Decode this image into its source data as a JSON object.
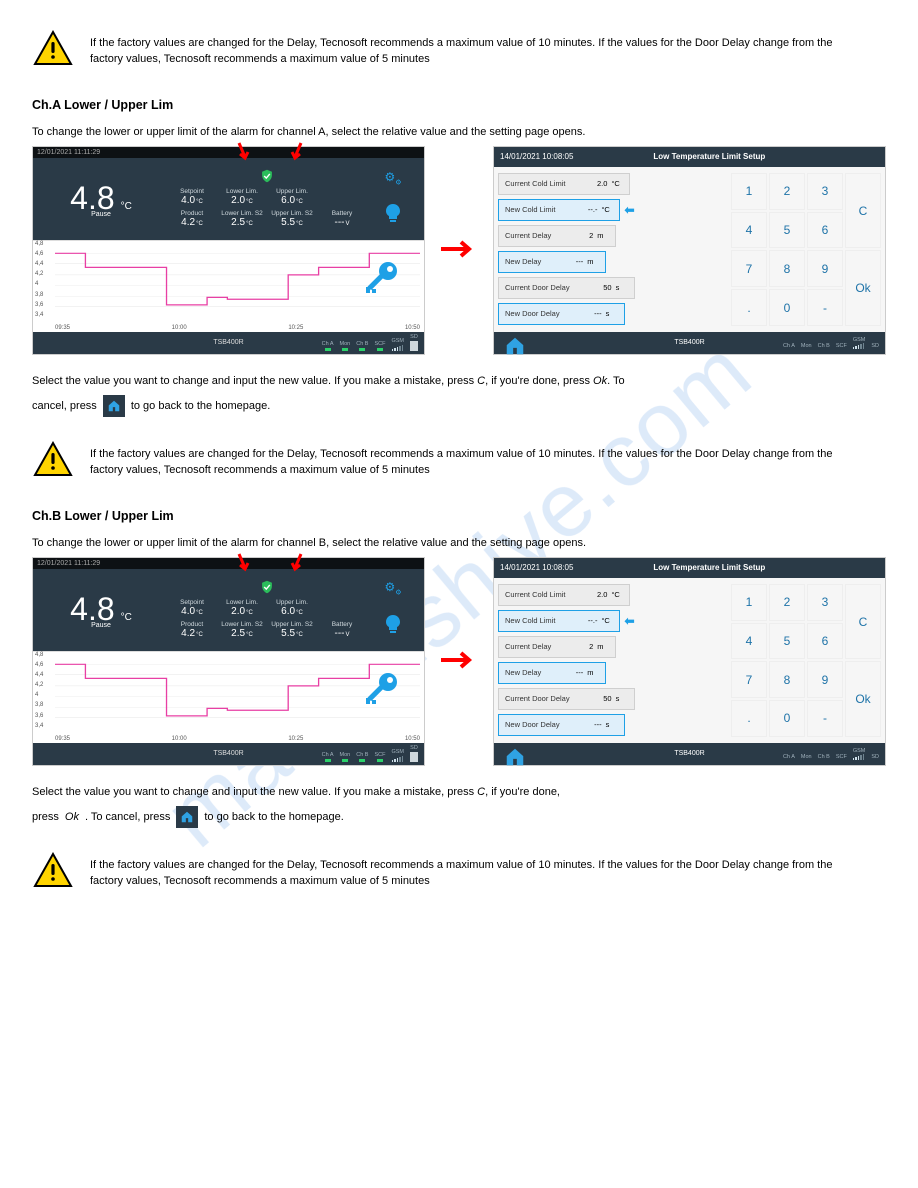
{
  "watermark": "manualshive.com",
  "warn1_text": "If the factory values are changed for the Delay, Tecnosoft recommends a maximum value of 10 minutes. If the\nvalues for the Door Delay change from the factory values, Tecnosoft recommends a maximum value of 5 minutes",
  "section2_title": "Ch.A Lower / Upper Lim",
  "section2_desc": "To change the lower or upper limit of the alarm for channel A, select the relative value and the setting page opens.",
  "left": {
    "timestamp": "12/01/2021 11:11:29",
    "temp_value": "4.8",
    "temp_unit": "°C",
    "pause": "Pause",
    "row1": [
      {
        "lbl": "Setpoint",
        "val": "4.0",
        "unit": "°C"
      },
      {
        "lbl": "Lower Lim.",
        "val": "2.0",
        "unit": "°C"
      },
      {
        "lbl": "Upper Lim.",
        "val": "6.0",
        "unit": "°C"
      }
    ],
    "row2": [
      {
        "lbl": "Product",
        "val": "4.2",
        "unit": "°C"
      },
      {
        "lbl": "Lower Lim. S2",
        "val": "2.5",
        "unit": "°C"
      },
      {
        "lbl": "Upper Lim. S2",
        "val": "5.5",
        "unit": "°C"
      },
      {
        "lbl": "Battery",
        "val": "---",
        "unit": "V"
      }
    ],
    "model": "TSB400R",
    "status_labels": [
      "Ch A",
      "Mon",
      "Ch B",
      "SCF",
      "GSM",
      "SD"
    ],
    "chart_y": [
      "4,8",
      "4,6",
      "4,4",
      "4,2",
      "4",
      "3,8",
      "3,6",
      "3,4"
    ],
    "chart_x": [
      "09:35",
      "10:00",
      "10:25",
      "10:50"
    ]
  },
  "right": {
    "timestamp": "14/01/2021 10:08:05",
    "title": "Low Temperature Limit Setup",
    "rows": [
      {
        "label": "Current Cold Limit",
        "val": "2.0",
        "unit": "°C",
        "active": false
      },
      {
        "label": "New Cold Limit",
        "val": "--.-",
        "unit": "°C",
        "active": true,
        "sel": true
      },
      {
        "label": "Current Delay",
        "val": "2",
        "unit": "m",
        "active": false
      },
      {
        "label": "New Delay",
        "val": "---",
        "unit": "m",
        "active": true
      },
      {
        "label": "Current Door Delay",
        "val": "50",
        "unit": "s",
        "active": false
      },
      {
        "label": "New Door Delay",
        "val": "---",
        "unit": "s",
        "active": true
      }
    ],
    "keypad": [
      "1",
      "2",
      "3",
      "C",
      "4",
      "5",
      "6",
      "7",
      "8",
      "9",
      "Ok",
      ".",
      "0",
      "-"
    ],
    "model": "TSB400R"
  },
  "chart_data": {
    "type": "line",
    "title": "",
    "xlabel": "",
    "ylabel": "",
    "ylim": [
      3.4,
      4.8
    ],
    "x_ticks": [
      "09:35",
      "10:00",
      "10:25",
      "10:50"
    ],
    "y_ticks": [
      4.8,
      4.6,
      4.4,
      4.2,
      4.0,
      3.8,
      3.6,
      3.4
    ],
    "series": [
      {
        "name": "temp",
        "x": [
          "09:35",
          "09:40",
          "09:45",
          "09:50",
          "10:00",
          "10:05",
          "10:10",
          "10:15",
          "10:20",
          "10:25",
          "10:35",
          "10:40",
          "10:45",
          "10:50",
          "10:55"
        ],
        "values": [
          4.6,
          4.6,
          4.3,
          4.3,
          4.3,
          3.6,
          3.6,
          3.8,
          3.7,
          3.7,
          4.2,
          4.3,
          4.3,
          4.3,
          4.6
        ]
      }
    ]
  },
  "after1_pre": "Select the value you want to change and input the new value. If you make a mistake, press",
  "after1_c": "C",
  "after1_mid": ", if you're done, press",
  "after1_ok": "Ok",
  "after1_end1": ". To",
  "after1_line2_pre": "cancel, press",
  "after1_line2_post": "to go back to the homepage.",
  "warn2_text": "If the factory values are changed for the Delay, Tecnosoft recommends a maximum value of 10 minutes. If the\nvalues for the Door Delay change from the factory values, Tecnosoft recommends a maximum value of 5 minutes",
  "section3_title": "Ch.B Lower / Upper Lim",
  "section3_desc": "To change the lower or upper limit of the alarm for channel B, select the relative value and the setting page opens.",
  "after2_pre": "Select the value you want to change and input the new value. If you make a mistake, press",
  "after2_c": "C",
  "after2_mid": ", if you're done,",
  "after2_line2_pre": "press",
  "after2_ok": "Ok",
  "after2_line2_mid": ". To cancel, press",
  "after2_line2_post": "to go back to the homepage.",
  "warn3_text": "If the factory values are changed for the Delay, Tecnosoft recommends a maximum value of 10 minutes. If the\nvalues for the Door Delay change from the factory values, Tecnosoft recommends a maximum value of 5 minutes"
}
